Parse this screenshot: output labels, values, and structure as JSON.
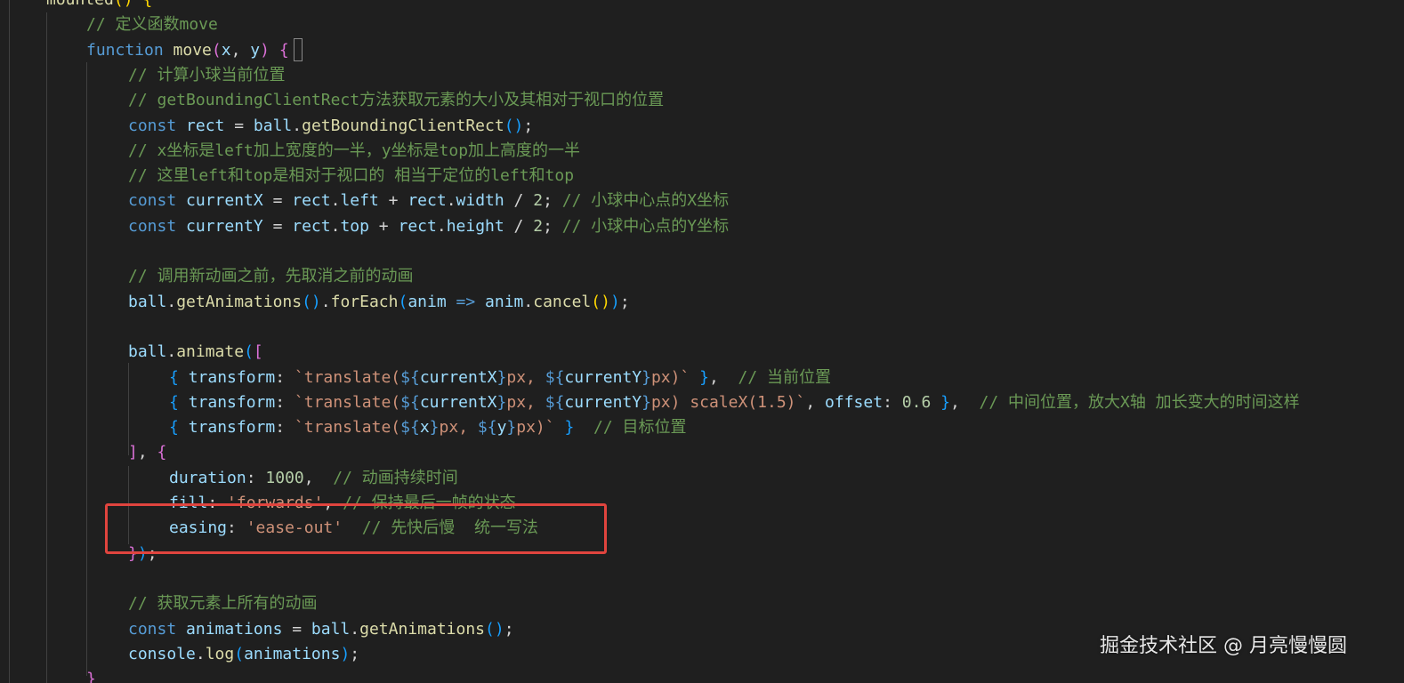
{
  "editor": {
    "lines": [
      [
        {
          "t": "mounted",
          "c": "fn"
        },
        {
          "t": "() ",
          "c": "p1"
        },
        {
          "t": "{",
          "c": "p1"
        }
      ],
      [
        {
          "t": "// 定义函数move",
          "c": "cmt"
        }
      ],
      [
        {
          "t": "function ",
          "c": "kw"
        },
        {
          "t": "move",
          "c": "fn"
        },
        {
          "t": "(",
          "c": "p2"
        },
        {
          "t": "x",
          "c": "var"
        },
        {
          "t": ", ",
          "c": "op"
        },
        {
          "t": "y",
          "c": "var"
        },
        {
          "t": ") ",
          "c": "p2"
        },
        {
          "t": "{",
          "c": "p2"
        }
      ],
      [
        {
          "t": "// 计算小球当前位置",
          "c": "cmt"
        }
      ],
      [
        {
          "t": "// getBoundingClientRect方法获取元素的大小及其相对于视口的位置",
          "c": "cmt"
        }
      ],
      [
        {
          "t": "const ",
          "c": "kw"
        },
        {
          "t": "rect",
          "c": "var"
        },
        {
          "t": " = ",
          "c": "op"
        },
        {
          "t": "ball",
          "c": "var"
        },
        {
          "t": ".",
          "c": "op"
        },
        {
          "t": "getBoundingClientRect",
          "c": "fn"
        },
        {
          "t": "()",
          "c": "p3"
        },
        {
          "t": ";",
          "c": "op"
        }
      ],
      [
        {
          "t": "// x坐标是left加上宽度的一半，y坐标是top加上高度的一半",
          "c": "cmt"
        }
      ],
      [
        {
          "t": "// 这里left和top是相对于视口的 相当于定位的left和top",
          "c": "cmt"
        }
      ],
      [
        {
          "t": "const ",
          "c": "kw"
        },
        {
          "t": "currentX",
          "c": "var"
        },
        {
          "t": " = ",
          "c": "op"
        },
        {
          "t": "rect",
          "c": "var"
        },
        {
          "t": ".",
          "c": "op"
        },
        {
          "t": "left",
          "c": "prop"
        },
        {
          "t": " + ",
          "c": "op"
        },
        {
          "t": "rect",
          "c": "var"
        },
        {
          "t": ".",
          "c": "op"
        },
        {
          "t": "width",
          "c": "prop"
        },
        {
          "t": " / ",
          "c": "op"
        },
        {
          "t": "2",
          "c": "num"
        },
        {
          "t": "; ",
          "c": "op"
        },
        {
          "t": "// 小球中心点的X坐标",
          "c": "cmt"
        }
      ],
      [
        {
          "t": "const ",
          "c": "kw"
        },
        {
          "t": "currentY",
          "c": "var"
        },
        {
          "t": " = ",
          "c": "op"
        },
        {
          "t": "rect",
          "c": "var"
        },
        {
          "t": ".",
          "c": "op"
        },
        {
          "t": "top",
          "c": "prop"
        },
        {
          "t": " + ",
          "c": "op"
        },
        {
          "t": "rect",
          "c": "var"
        },
        {
          "t": ".",
          "c": "op"
        },
        {
          "t": "height",
          "c": "prop"
        },
        {
          "t": " / ",
          "c": "op"
        },
        {
          "t": "2",
          "c": "num"
        },
        {
          "t": "; ",
          "c": "op"
        },
        {
          "t": "// 小球中心点的Y坐标",
          "c": "cmt"
        }
      ],
      [],
      [
        {
          "t": "// 调用新动画之前，先取消之前的动画",
          "c": "cmt"
        }
      ],
      [
        {
          "t": "ball",
          "c": "var"
        },
        {
          "t": ".",
          "c": "op"
        },
        {
          "t": "getAnimations",
          "c": "fn"
        },
        {
          "t": "()",
          "c": "p3"
        },
        {
          "t": ".",
          "c": "op"
        },
        {
          "t": "forEach",
          "c": "fn"
        },
        {
          "t": "(",
          "c": "p3"
        },
        {
          "t": "anim",
          "c": "var"
        },
        {
          "t": " => ",
          "c": "kw"
        },
        {
          "t": "anim",
          "c": "var"
        },
        {
          "t": ".",
          "c": "op"
        },
        {
          "t": "cancel",
          "c": "fn"
        },
        {
          "t": "()",
          "c": "p1"
        },
        {
          "t": ")",
          "c": "p3"
        },
        {
          "t": ";",
          "c": "op"
        }
      ],
      [],
      [
        {
          "t": "ball",
          "c": "var"
        },
        {
          "t": ".",
          "c": "op"
        },
        {
          "t": "animate",
          "c": "fn"
        },
        {
          "t": "(",
          "c": "p3"
        },
        {
          "t": "[",
          "c": "p2"
        }
      ],
      [
        {
          "t": "{ ",
          "c": "p3"
        },
        {
          "t": "transform",
          "c": "prop"
        },
        {
          "t": ": ",
          "c": "op"
        },
        {
          "t": "`translate(",
          "c": "str"
        },
        {
          "t": "${",
          "c": "kw"
        },
        {
          "t": "currentX",
          "c": "var"
        },
        {
          "t": "}",
          "c": "kw"
        },
        {
          "t": "px, ",
          "c": "str"
        },
        {
          "t": "${",
          "c": "kw"
        },
        {
          "t": "currentY",
          "c": "var"
        },
        {
          "t": "}",
          "c": "kw"
        },
        {
          "t": "px)`",
          "c": "str"
        },
        {
          "t": " }",
          "c": "p3"
        },
        {
          "t": ",  ",
          "c": "op"
        },
        {
          "t": "// 当前位置",
          "c": "cmt"
        }
      ],
      [
        {
          "t": "{ ",
          "c": "p3"
        },
        {
          "t": "transform",
          "c": "prop"
        },
        {
          "t": ": ",
          "c": "op"
        },
        {
          "t": "`translate(",
          "c": "str"
        },
        {
          "t": "${",
          "c": "kw"
        },
        {
          "t": "currentX",
          "c": "var"
        },
        {
          "t": "}",
          "c": "kw"
        },
        {
          "t": "px, ",
          "c": "str"
        },
        {
          "t": "${",
          "c": "kw"
        },
        {
          "t": "currentY",
          "c": "var"
        },
        {
          "t": "}",
          "c": "kw"
        },
        {
          "t": "px) scaleX(1.5)`",
          "c": "str"
        },
        {
          "t": ", ",
          "c": "op"
        },
        {
          "t": "offset",
          "c": "prop"
        },
        {
          "t": ": ",
          "c": "op"
        },
        {
          "t": "0.6",
          "c": "num"
        },
        {
          "t": " }",
          "c": "p3"
        },
        {
          "t": ",  ",
          "c": "op"
        },
        {
          "t": "// 中间位置，放大X轴 加长变大的时间这样",
          "c": "cmt"
        }
      ],
      [
        {
          "t": "{ ",
          "c": "p3"
        },
        {
          "t": "transform",
          "c": "prop"
        },
        {
          "t": ": ",
          "c": "op"
        },
        {
          "t": "`translate(",
          "c": "str"
        },
        {
          "t": "${",
          "c": "kw"
        },
        {
          "t": "x",
          "c": "var"
        },
        {
          "t": "}",
          "c": "kw"
        },
        {
          "t": "px, ",
          "c": "str"
        },
        {
          "t": "${",
          "c": "kw"
        },
        {
          "t": "y",
          "c": "var"
        },
        {
          "t": "}",
          "c": "kw"
        },
        {
          "t": "px)`",
          "c": "str"
        },
        {
          "t": " }",
          "c": "p3"
        },
        {
          "t": "  ",
          "c": "op"
        },
        {
          "t": "// 目标位置",
          "c": "cmt"
        }
      ],
      [
        {
          "t": "]",
          "c": "p2"
        },
        {
          "t": ", ",
          "c": "op"
        },
        {
          "t": "{",
          "c": "p2"
        }
      ],
      [
        {
          "t": "duration",
          "c": "prop"
        },
        {
          "t": ": ",
          "c": "op"
        },
        {
          "t": "1000",
          "c": "num"
        },
        {
          "t": ",  ",
          "c": "op"
        },
        {
          "t": "// 动画持续时间",
          "c": "cmt"
        }
      ],
      [
        {
          "t": "fill",
          "c": "prop"
        },
        {
          "t": ": ",
          "c": "op"
        },
        {
          "t": "'forwards'",
          "c": "str"
        },
        {
          "t": ", ",
          "c": "op"
        },
        {
          "t": "// 保持最后一帧的状态",
          "c": "cmt"
        }
      ],
      [
        {
          "t": "easing",
          "c": "prop"
        },
        {
          "t": ": ",
          "c": "op"
        },
        {
          "t": "'ease-out'",
          "c": "str"
        },
        {
          "t": "  ",
          "c": "op"
        },
        {
          "t": "// 先快后慢  统一写法",
          "c": "cmt"
        }
      ],
      [
        {
          "t": "}",
          "c": "p2"
        },
        {
          "t": ")",
          "c": "p3"
        },
        {
          "t": ";",
          "c": "op"
        }
      ],
      [],
      [
        {
          "t": "// 获取元素上所有的动画",
          "c": "cmt"
        }
      ],
      [
        {
          "t": "const ",
          "c": "kw"
        },
        {
          "t": "animations",
          "c": "var"
        },
        {
          "t": " = ",
          "c": "op"
        },
        {
          "t": "ball",
          "c": "var"
        },
        {
          "t": ".",
          "c": "op"
        },
        {
          "t": "getAnimations",
          "c": "fn"
        },
        {
          "t": "()",
          "c": "p3"
        },
        {
          "t": ";",
          "c": "op"
        }
      ],
      [
        {
          "t": "console",
          "c": "var"
        },
        {
          "t": ".",
          "c": "op"
        },
        {
          "t": "log",
          "c": "fn"
        },
        {
          "t": "(",
          "c": "p3"
        },
        {
          "t": "animations",
          "c": "var"
        },
        {
          "t": ")",
          "c": "p3"
        },
        {
          "t": ";",
          "c": "op"
        }
      ],
      [
        {
          "t": "}",
          "c": "p2"
        }
      ]
    ]
  },
  "watermark": {
    "text": "掘金技术社区 @ 月亮慢慢圆"
  },
  "colors": {
    "background": "#1f1f1f",
    "keyword": "#569cd6",
    "function": "#dcdcaa",
    "variable": "#9cdcfe",
    "string": "#ce9178",
    "number": "#b5cea8",
    "comment": "#6a9955",
    "highlight_box": "#e0443e"
  }
}
